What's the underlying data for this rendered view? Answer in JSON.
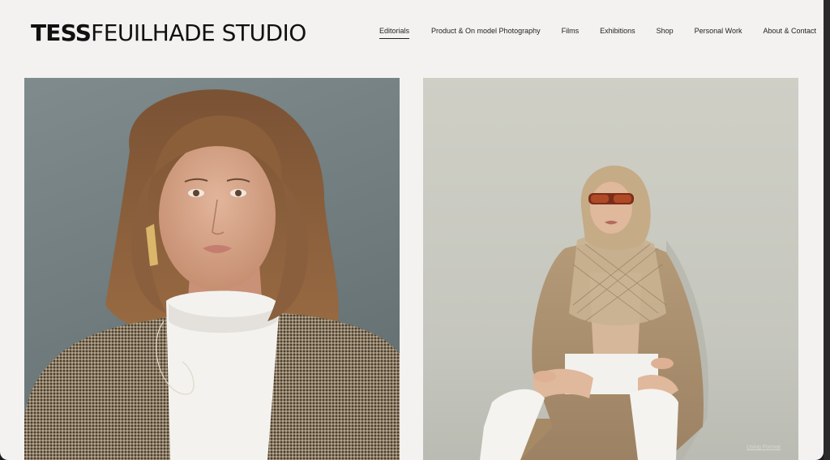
{
  "site": {
    "logo_bold": "TESS",
    "logo_light": "FEUILHADE STUDIO"
  },
  "nav": {
    "items": [
      {
        "label": "Editorials",
        "active": true
      },
      {
        "label": "Product & On model Photography",
        "active": false
      },
      {
        "label": "Films",
        "active": false
      },
      {
        "label": "Exhibitions",
        "active": false
      },
      {
        "label": "Shop",
        "active": false
      },
      {
        "label": "Personal Work",
        "active": false
      },
      {
        "label": "About & Contact",
        "active": false
      }
    ]
  },
  "gallery": {
    "left_photo": "portrait-houndstooth-blazer",
    "right_photo": "model-trench-headscarf-sunglasses"
  },
  "footer": {
    "badge": "Using Format"
  },
  "colors": {
    "background": "#f3f2f0",
    "text": "#111111"
  }
}
